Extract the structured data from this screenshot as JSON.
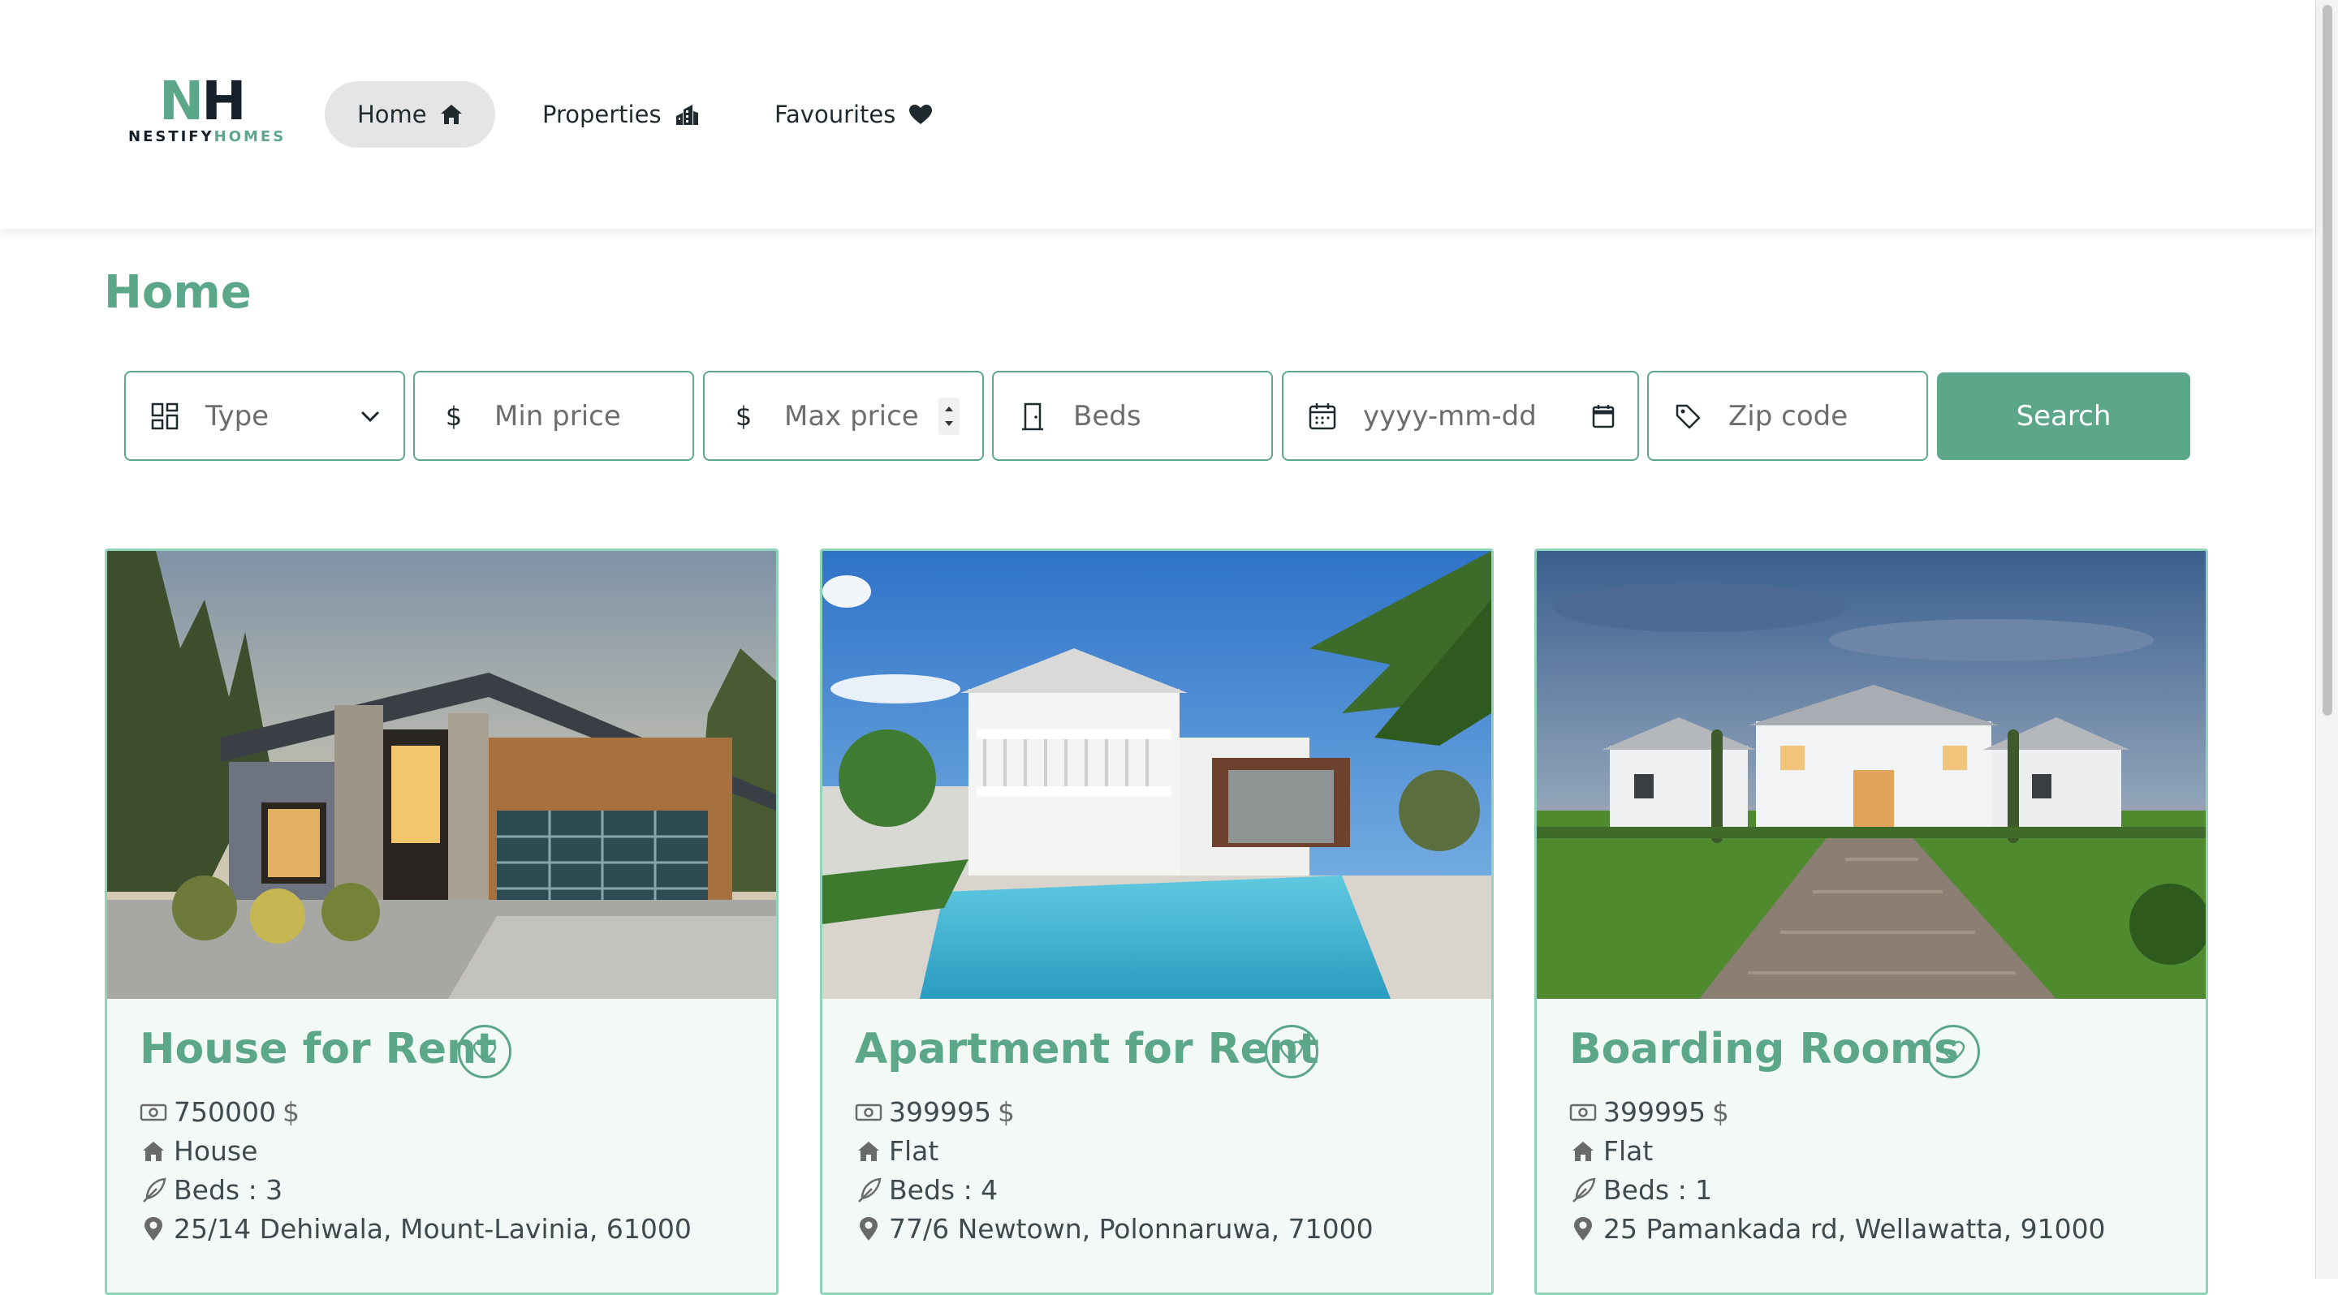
{
  "brand": {
    "mark_n": "N",
    "mark_h": "H",
    "name_a": "NESTIFY",
    "name_b": "HOMES"
  },
  "nav": {
    "items": [
      {
        "label": "Home",
        "icon": "home-icon",
        "active": true
      },
      {
        "label": "Properties",
        "icon": "building-icon",
        "active": false
      },
      {
        "label": "Favourites",
        "icon": "heart-icon",
        "active": false
      }
    ]
  },
  "page": {
    "title": "Home"
  },
  "search": {
    "type_label": "Type",
    "min_price_placeholder": "Min price",
    "max_price_placeholder": "Max price",
    "beds_placeholder": "Beds",
    "date_placeholder": "yyyy-mm-dd",
    "zip_placeholder": "Zip code",
    "currency_symbol": "$",
    "button_label": "Search"
  },
  "colors": {
    "accent": "#5ca78a",
    "card_border": "#8fd4b8",
    "card_bg": "#f3f9f6"
  },
  "listings": [
    {
      "title": "House for Rent",
      "price": "750000",
      "currency": "$",
      "type": "House",
      "beds": "Beds : 3",
      "address": "25/14 Dehiwala, Mount-Lavinia, 61000",
      "image": "modern-house-photo"
    },
    {
      "title": "Apartment for Rent",
      "price": "399995",
      "currency": "$",
      "type": "Flat",
      "beds": "Beds : 4",
      "address": "77/6 Newtown, Polonnaruwa, 71000",
      "image": "pool-villa-photo"
    },
    {
      "title": "Boarding Rooms",
      "price": "399995",
      "currency": "$",
      "type": "Flat",
      "beds": "Beds : 1",
      "address": "25 Pamankada rd, Wellawatta, 91000",
      "image": "mansion-driveway-photo"
    }
  ]
}
